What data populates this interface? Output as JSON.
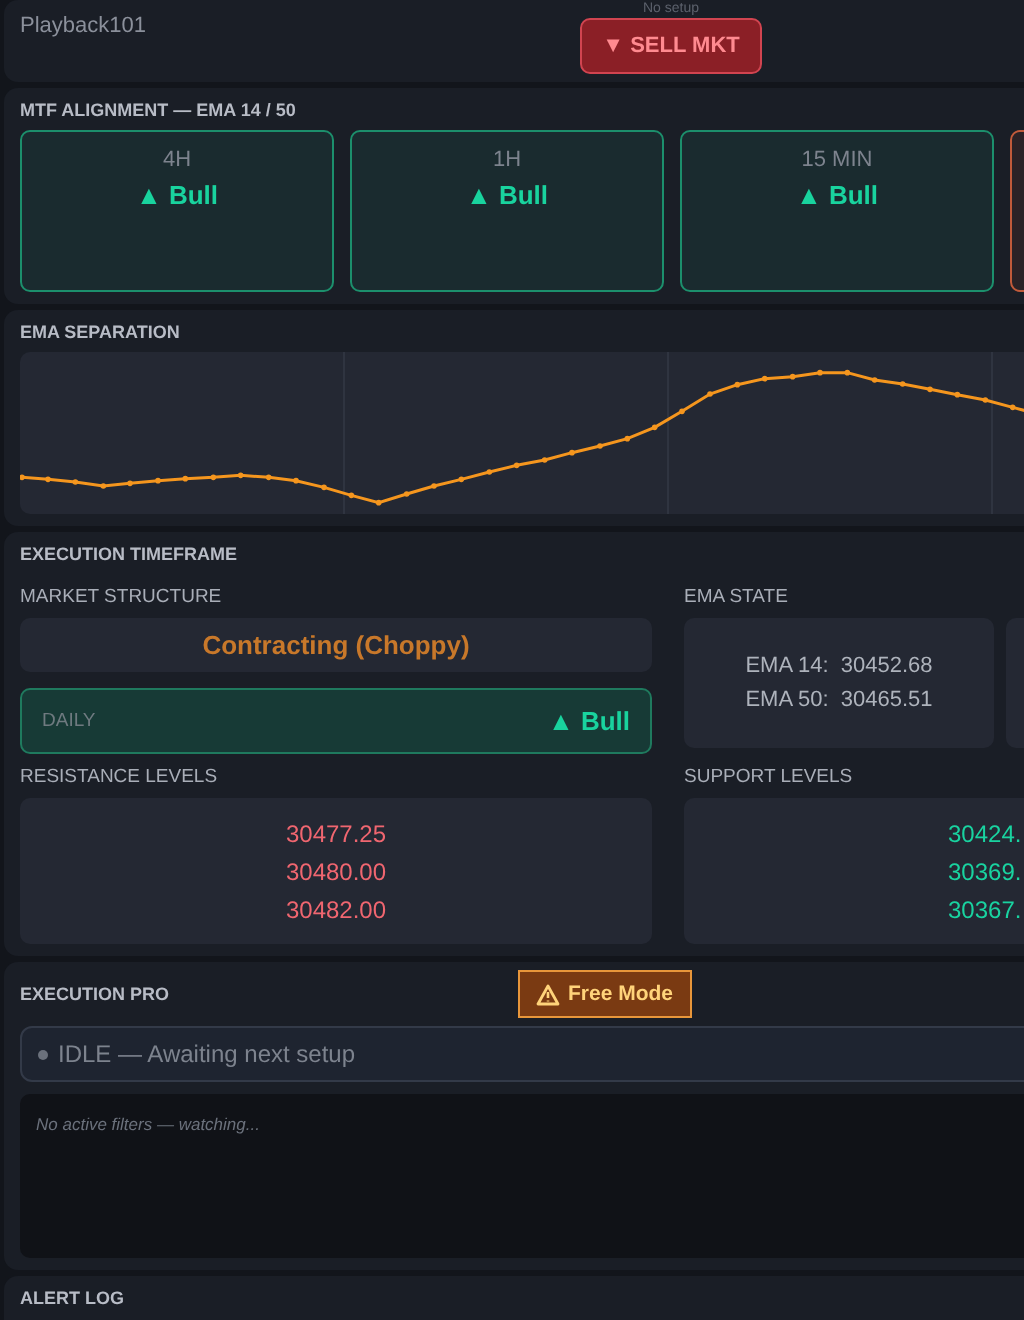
{
  "header": {
    "account": "Playback101",
    "setup_status": "No setup",
    "action_button": {
      "label": "▼ SELL MKT"
    }
  },
  "mtf_alignment": {
    "title": "MTF ALIGNMENT — EMA 14 / 50",
    "timeframes": [
      {
        "label": "4H",
        "trend": "▲ Bull",
        "bullish": true
      },
      {
        "label": "1H",
        "trend": "▲ Bull",
        "bullish": true
      },
      {
        "label": "15 MIN",
        "trend": "▲ Bull",
        "bullish": true
      },
      {
        "bullish": false
      }
    ]
  },
  "ema_separation": {
    "title": "EMA SEPARATION"
  },
  "execution_timeframe": {
    "title": "EXECUTION TIMEFRAME",
    "market_structure": {
      "label": "MARKET STRUCTURE",
      "value": "Contracting (Choppy)"
    },
    "daily": {
      "label": "DAILY",
      "trend": "▲ Bull",
      "bullish": true
    },
    "ema_state": {
      "label": "EMA STATE",
      "lines": [
        {
          "name": "EMA 14:",
          "value": "30452.68"
        },
        {
          "name": "EMA 50:",
          "value": "30465.51"
        }
      ]
    },
    "resistance": {
      "label": "RESISTANCE LEVELS",
      "levels": [
        "30477.25",
        "30480.00",
        "30482.00"
      ]
    },
    "support": {
      "label": "SUPPORT LEVELS",
      "levels": [
        "30424.",
        "30369.",
        "30367."
      ]
    }
  },
  "execution_pro": {
    "title": "EXECUTION PRO",
    "mode_badge": "Free Mode",
    "status": "IDLE — Awaiting next setup",
    "filters_note": "No active filters — watching..."
  },
  "alert_log": {
    "title": "ALERT LOG"
  }
}
